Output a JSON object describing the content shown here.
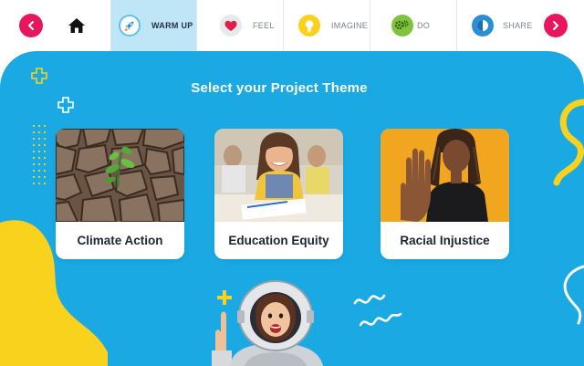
{
  "nav": {
    "prev_icon": "chevron-left-icon",
    "next_icon": "chevron-right-icon",
    "home_icon": "home-icon",
    "steps": [
      {
        "label": "WARM UP",
        "icon": "rocket-icon",
        "active": true
      },
      {
        "label": "FEEL",
        "icon": "heart-icon",
        "active": false
      },
      {
        "label": "IMAGINE",
        "icon": "lightbulb-icon",
        "active": false
      },
      {
        "label": "DO",
        "icon": "gears-icon",
        "active": false
      },
      {
        "label": "SHARE",
        "icon": "share-icon",
        "active": false
      }
    ]
  },
  "main": {
    "title": "Select your Project Theme",
    "themes": [
      {
        "label": "Climate Action",
        "image": "cracked-earth-seedling-photo"
      },
      {
        "label": "Education Equity",
        "image": "student-at-desk-photo"
      },
      {
        "label": "Racial Injustice",
        "image": "raised-hand-stop-photo"
      }
    ],
    "illustration": "child-astronaut-illustration"
  },
  "colors": {
    "accent_pink": "#e8175d",
    "panel_blue": "#1aa9e3",
    "active_tab": "#bfe6f7",
    "deco_yellow": "#f8d21c"
  }
}
